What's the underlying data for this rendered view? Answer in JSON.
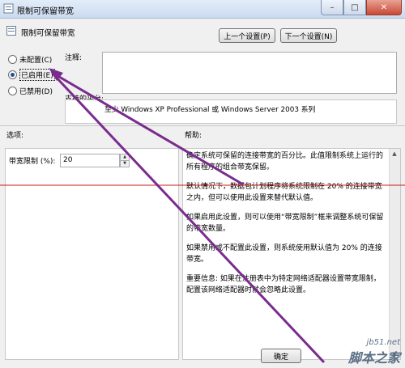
{
  "window": {
    "title": "限制可保留带宽",
    "min": "–",
    "max": "□",
    "close": "✕"
  },
  "header": {
    "title": "限制可保留带宽"
  },
  "nav": {
    "prev": "上一个设置(P)",
    "next": "下一个设置(N)"
  },
  "options": [
    {
      "label": "未配置(C)",
      "selected": false
    },
    {
      "label": "已启用(E)",
      "selected": true
    },
    {
      "label": "已禁用(D)",
      "selected": false
    }
  ],
  "comment": {
    "label": "注释:",
    "value": ""
  },
  "supported": {
    "label": "支持的平台:",
    "value": "至少 Windows XP Professional 或 Windows Server 2003 系列"
  },
  "options_section": {
    "label": "选项:",
    "field_label": "带宽限制 (%):",
    "field_value": "20"
  },
  "help_section": {
    "label": "帮助:",
    "paragraphs": [
      "确定系统可保留的连接带宽的百分比。此值限制系统上运行的所有程序的组合带宽保留。",
      "默认情况下，数据包计划程序将系统限制在 20% 的连接带宽之内，但可以使用此设置来替代默认值。",
      "如果启用此设置，则可以使用“带宽限制”框来调整系统可保留的带宽数量。",
      "如果禁用或不配置此设置，则系统使用默认值为 20% 的连接带宽。",
      "重要信息: 如果在注册表中为特定网络适配器设置带宽限制，配置该网络适配器时就会忽略此设置。"
    ]
  },
  "footer": {
    "ok": "确定"
  },
  "watermark": {
    "line1": "jb51.net",
    "line2": "脚本之家"
  },
  "annotation_colors": {
    "arrow": "#7a2c8e",
    "line": "#d11a1a"
  }
}
